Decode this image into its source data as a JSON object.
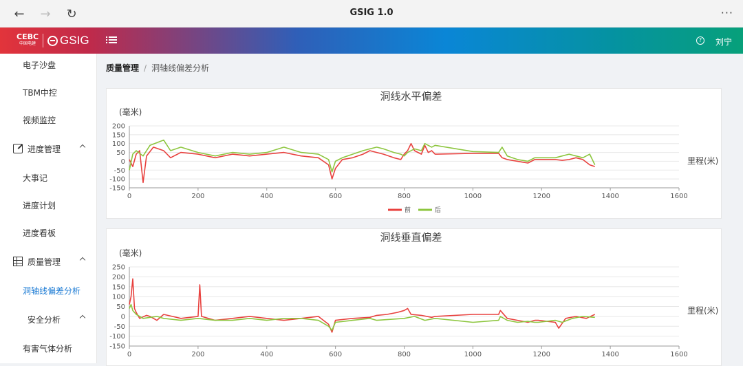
{
  "browser": {
    "title": "GSIG 1.0",
    "back_icon": "arrow-left-icon",
    "forward_icon": "arrow-right-icon",
    "reload_icon": "reload-icon",
    "more_icon": "more-icon",
    "back": "←",
    "forward": "→",
    "reload": "↻",
    "more": "···"
  },
  "header": {
    "logo_cecc": "CEBC",
    "logo_cecc_sub": "中国电建",
    "logo_gsig": "GSIG",
    "user": "刘宁",
    "help": "?",
    "colors": [
      "#e2343b",
      "#0a86d6",
      "#07a07a"
    ]
  },
  "sidebar": {
    "items": [
      {
        "label": "电子沙盘"
      },
      {
        "label": "TBM中控"
      },
      {
        "label": "视频监控"
      },
      {
        "label": "进度管理"
      },
      {
        "label": "大事记"
      },
      {
        "label": "进度计划"
      },
      {
        "label": "进度看板"
      },
      {
        "label": "质量管理"
      },
      {
        "label": "洞轴线偏差分析"
      },
      {
        "label": "安全分析"
      },
      {
        "label": "有害气体分析"
      }
    ],
    "active_color": "#1c7bd4"
  },
  "breadcrumb": {
    "root": "质量管理",
    "separator": "/",
    "current": "洞轴线偏差分析"
  },
  "chart_data": [
    {
      "type": "line",
      "title": "洞线水平偏差",
      "ylabel": "(毫米)",
      "xlabel": "里程(米)",
      "xlim": [
        0,
        1600
      ],
      "ylim": [
        -150,
        200
      ],
      "xticks": [
        0,
        200,
        400,
        600,
        800,
        1000,
        1200,
        1400,
        1600
      ],
      "yticks": [
        200,
        150,
        100,
        50,
        0,
        -50,
        -100,
        -150
      ],
      "legend": "bottom",
      "series": [
        {
          "name": "前",
          "color": "#e8413e",
          "points": [
            [
              0,
              10
            ],
            [
              10,
              -30
            ],
            [
              20,
              40
            ],
            [
              30,
              60
            ],
            [
              40,
              -120
            ],
            [
              50,
              30
            ],
            [
              70,
              80
            ],
            [
              100,
              60
            ],
            [
              120,
              20
            ],
            [
              150,
              50
            ],
            [
              200,
              40
            ],
            [
              250,
              20
            ],
            [
              300,
              40
            ],
            [
              350,
              30
            ],
            [
              400,
              40
            ],
            [
              450,
              50
            ],
            [
              500,
              30
            ],
            [
              550,
              20
            ],
            [
              580,
              -20
            ],
            [
              590,
              -100
            ],
            [
              600,
              -40
            ],
            [
              620,
              10
            ],
            [
              650,
              20
            ],
            [
              680,
              40
            ],
            [
              700,
              60
            ],
            [
              720,
              50
            ],
            [
              740,
              40
            ],
            [
              770,
              20
            ],
            [
              790,
              10
            ],
            [
              800,
              40
            ],
            [
              810,
              60
            ],
            [
              820,
              100
            ],
            [
              830,
              60
            ],
            [
              850,
              40
            ],
            [
              860,
              90
            ],
            [
              870,
              50
            ],
            [
              880,
              60
            ],
            [
              890,
              40
            ],
            [
              1000,
              45
            ],
            [
              1075,
              45
            ],
            [
              1085,
              20
            ],
            [
              1100,
              10
            ],
            [
              1130,
              0
            ],
            [
              1160,
              -10
            ],
            [
              1180,
              10
            ],
            [
              1190,
              10
            ],
            [
              1240,
              10
            ],
            [
              1260,
              5
            ],
            [
              1280,
              10
            ],
            [
              1300,
              20
            ],
            [
              1320,
              10
            ],
            [
              1340,
              -20
            ],
            [
              1355,
              -30
            ]
          ]
        },
        {
          "name": "后",
          "color": "#8dc63f",
          "points": [
            [
              0,
              -50
            ],
            [
              10,
              40
            ],
            [
              20,
              60
            ],
            [
              40,
              30
            ],
            [
              60,
              90
            ],
            [
              100,
              120
            ],
            [
              120,
              60
            ],
            [
              150,
              80
            ],
            [
              200,
              50
            ],
            [
              250,
              30
            ],
            [
              300,
              50
            ],
            [
              350,
              40
            ],
            [
              400,
              50
            ],
            [
              450,
              80
            ],
            [
              500,
              50
            ],
            [
              550,
              40
            ],
            [
              580,
              10
            ],
            [
              590,
              -60
            ],
            [
              600,
              0
            ],
            [
              620,
              20
            ],
            [
              650,
              40
            ],
            [
              680,
              60
            ],
            [
              700,
              70
            ],
            [
              720,
              80
            ],
            [
              740,
              70
            ],
            [
              770,
              50
            ],
            [
              790,
              40
            ],
            [
              800,
              30
            ],
            [
              810,
              50
            ],
            [
              830,
              70
            ],
            [
              850,
              60
            ],
            [
              860,
              100
            ],
            [
              880,
              80
            ],
            [
              890,
              90
            ],
            [
              1000,
              55
            ],
            [
              1075,
              50
            ],
            [
              1085,
              80
            ],
            [
              1100,
              30
            ],
            [
              1130,
              10
            ],
            [
              1160,
              0
            ],
            [
              1180,
              20
            ],
            [
              1190,
              20
            ],
            [
              1240,
              20
            ],
            [
              1260,
              30
            ],
            [
              1280,
              40
            ],
            [
              1300,
              30
            ],
            [
              1320,
              20
            ],
            [
              1340,
              40
            ],
            [
              1355,
              -20
            ]
          ]
        }
      ]
    },
    {
      "type": "line",
      "title": "洞线垂直偏差",
      "ylabel": "(毫米)",
      "xlabel": "里程(米)",
      "xlim": [
        0,
        1600
      ],
      "ylim": [
        -150,
        250
      ],
      "xticks": [
        0,
        200,
        400,
        600,
        800,
        1000,
        1200,
        1400,
        1600
      ],
      "yticks": [
        250,
        200,
        150,
        100,
        50,
        0,
        -50,
        -100,
        -150
      ],
      "series": [
        {
          "name": "前",
          "color": "#e8413e",
          "points": [
            [
              0,
              60
            ],
            [
              5,
              100
            ],
            [
              10,
              190
            ],
            [
              15,
              40
            ],
            [
              20,
              20
            ],
            [
              30,
              -10
            ],
            [
              50,
              5
            ],
            [
              60,
              0
            ],
            [
              80,
              -20
            ],
            [
              100,
              10
            ],
            [
              150,
              -10
            ],
            [
              200,
              0
            ],
            [
              205,
              160
            ],
            [
              210,
              0
            ],
            [
              250,
              -20
            ],
            [
              300,
              -10
            ],
            [
              350,
              0
            ],
            [
              400,
              -10
            ],
            [
              450,
              -20
            ],
            [
              500,
              -10
            ],
            [
              550,
              0
            ],
            [
              580,
              -40
            ],
            [
              590,
              -80
            ],
            [
              600,
              -20
            ],
            [
              650,
              -10
            ],
            [
              700,
              -5
            ],
            [
              720,
              5
            ],
            [
              750,
              10
            ],
            [
              780,
              20
            ],
            [
              800,
              30
            ],
            [
              810,
              40
            ],
            [
              820,
              10
            ],
            [
              850,
              5
            ],
            [
              880,
              -5
            ],
            [
              890,
              0
            ],
            [
              1000,
              10
            ],
            [
              1075,
              10
            ],
            [
              1080,
              30
            ],
            [
              1100,
              -10
            ],
            [
              1130,
              -20
            ],
            [
              1160,
              -30
            ],
            [
              1180,
              -20
            ],
            [
              1190,
              -20
            ],
            [
              1240,
              -30
            ],
            [
              1250,
              -60
            ],
            [
              1270,
              -10
            ],
            [
              1300,
              0
            ],
            [
              1330,
              -10
            ],
            [
              1355,
              10
            ]
          ]
        },
        {
          "name": "后",
          "color": "#8dc63f",
          "points": [
            [
              0,
              40
            ],
            [
              5,
              60
            ],
            [
              10,
              30
            ],
            [
              20,
              10
            ],
            [
              40,
              -10
            ],
            [
              80,
              0
            ],
            [
              100,
              -10
            ],
            [
              150,
              -20
            ],
            [
              200,
              -10
            ],
            [
              250,
              -20
            ],
            [
              300,
              -20
            ],
            [
              350,
              -10
            ],
            [
              400,
              -20
            ],
            [
              450,
              -10
            ],
            [
              500,
              -10
            ],
            [
              550,
              -20
            ],
            [
              580,
              -50
            ],
            [
              590,
              -70
            ],
            [
              600,
              -30
            ],
            [
              650,
              -20
            ],
            [
              700,
              -10
            ],
            [
              720,
              -20
            ],
            [
              760,
              -15
            ],
            [
              800,
              -10
            ],
            [
              830,
              0
            ],
            [
              860,
              -20
            ],
            [
              890,
              -10
            ],
            [
              1000,
              -30
            ],
            [
              1075,
              -20
            ],
            [
              1080,
              0
            ],
            [
              1100,
              -20
            ],
            [
              1130,
              -30
            ],
            [
              1160,
              -25
            ],
            [
              1180,
              -30
            ],
            [
              1190,
              -30
            ],
            [
              1240,
              -20
            ],
            [
              1260,
              -30
            ],
            [
              1290,
              -10
            ],
            [
              1320,
              0
            ],
            [
              1355,
              -5
            ]
          ]
        }
      ]
    }
  ]
}
